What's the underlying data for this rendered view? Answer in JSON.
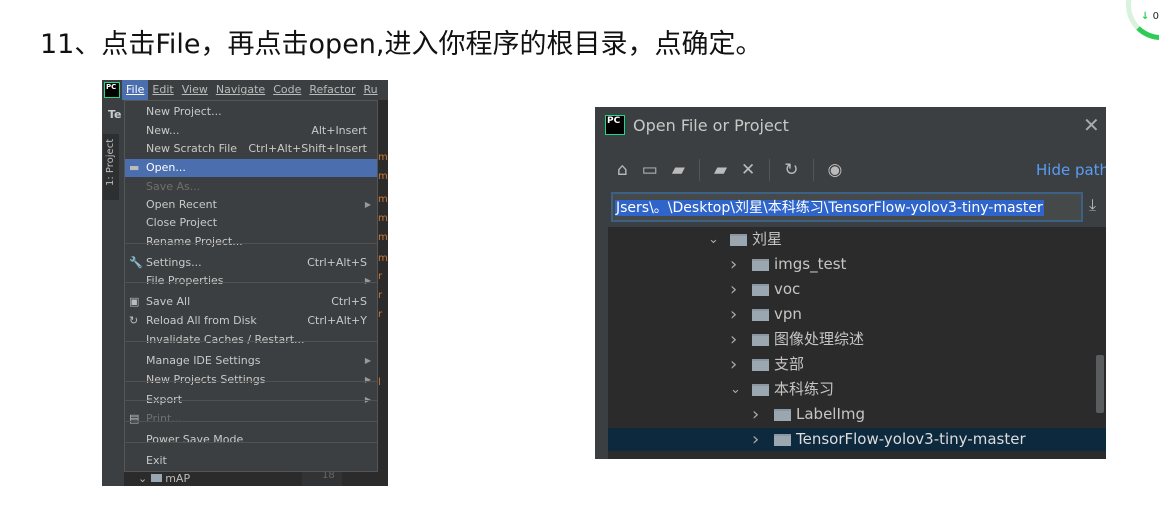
{
  "heading": "11、点击File，再点击open,进入你程序的根目录，点确定。",
  "badge": {
    "text": "0.",
    "arrow": "↓",
    "color": "#2ecc55"
  },
  "ide": {
    "logo": "PC",
    "menubar": [
      "File",
      "Edit",
      "View",
      "Navigate",
      "Code",
      "Refactor",
      "Ru"
    ],
    "project_abbrev": "Te",
    "project_tab": "1: Project",
    "file_menu": [
      {
        "label": "New Project..."
      },
      {
        "label": "New...",
        "shortcut": "Alt+Insert"
      },
      {
        "label": "New Scratch File",
        "shortcut": "Ctrl+Alt+Shift+Insert"
      },
      {
        "label": "Open...",
        "icon": "folder-open-icon",
        "selected": true
      },
      {
        "label": "Save As...",
        "disabled": true
      },
      {
        "label": "Open Recent",
        "submenu": true
      },
      {
        "label": "Close Project"
      },
      {
        "label": "Rename Project..."
      },
      {
        "label": "Settings...",
        "shortcut": "Ctrl+Alt+S",
        "icon": "wrench-icon"
      },
      {
        "label": "File Properties",
        "submenu": true
      },
      {
        "label": "Save All",
        "shortcut": "Ctrl+S",
        "icon": "save-icon"
      },
      {
        "label": "Reload All from Disk",
        "shortcut": "Ctrl+Alt+Y",
        "icon": "reload-icon"
      },
      {
        "label": "Invalidate Caches / Restart..."
      },
      {
        "label": "Manage IDE Settings",
        "submenu": true
      },
      {
        "label": "New Projects Settings",
        "submenu": true
      },
      {
        "label": "Export",
        "submenu": true
      },
      {
        "label": "Print...",
        "disabled": true,
        "icon": "print-icon"
      },
      {
        "label": "Power Save Mode"
      },
      {
        "label": "Exit"
      }
    ],
    "bottom_folder": "mAP",
    "line_number": "18",
    "accent": "#4b6eaf"
  },
  "dialog": {
    "title": "Open File or Project",
    "logo": "PC",
    "hide_path": "Hide path",
    "path": "Jsers\\。\\Desktop\\刘星\\本科练习\\TensorFlow-yolov3-tiny-master",
    "toolbar_icons": [
      "home-icon",
      "desktop-icon",
      "project-folder-icon",
      "new-folder-icon",
      "delete-icon",
      "refresh-icon",
      "show-hidden-icon"
    ],
    "tree": [
      {
        "label": "刘星",
        "expanded": true,
        "level": 0
      },
      {
        "label": "imgs_test",
        "expanded": false,
        "level": 1
      },
      {
        "label": "voc",
        "expanded": false,
        "level": 1
      },
      {
        "label": "vpn",
        "expanded": false,
        "level": 1
      },
      {
        "label": "图像处理综述",
        "expanded": false,
        "level": 1
      },
      {
        "label": "支部",
        "expanded": false,
        "level": 1
      },
      {
        "label": "本科练习",
        "expanded": true,
        "level": 1
      },
      {
        "label": "LabelImg",
        "expanded": false,
        "level": 2
      },
      {
        "label": "TensorFlow-yolov3-tiny-master",
        "expanded": false,
        "level": 2,
        "selected": true
      }
    ],
    "selection_color": "#0d293e",
    "link_color": "#589df6"
  }
}
